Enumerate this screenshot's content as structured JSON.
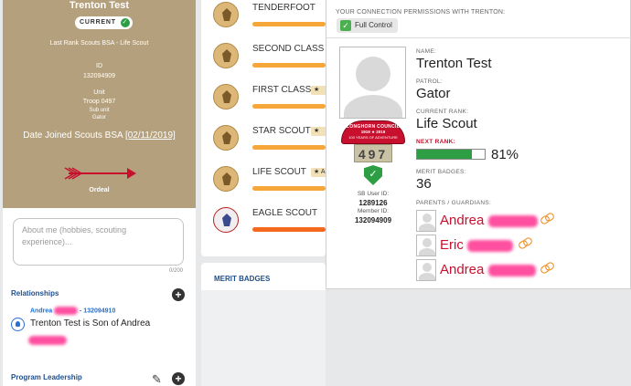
{
  "profile": {
    "name": "Trenton Test",
    "status": "CURRENT",
    "last_rank": "Last Rank Scouts BSA - Life Scout",
    "id_label": "ID",
    "id_value": "132094909",
    "unit_label": "Unit",
    "unit_value": "Troop 0497",
    "subunit_label": "Sub unit",
    "subunit_value": "Gator",
    "date_joined_label": "Date Joined Scouts BSA",
    "date_joined_value": "[02/11/2019]",
    "ordeal": "Ordeal"
  },
  "about": {
    "placeholder": "About me (hobbies, scouting experience)...",
    "count": "0/200"
  },
  "relationships": {
    "title": "Relationships",
    "link_prefix": "Andrea",
    "link_suffix": "- 132094910",
    "text": "Trenton Test is Son of Andrea"
  },
  "program_leadership": {
    "title": "Program Leadership"
  },
  "ranks": {
    "items": [
      {
        "name": "TENDERFOOT",
        "tag": "",
        "progress": 1.0
      },
      {
        "name": "SECOND CLASS",
        "tag": "",
        "progress": 1.0
      },
      {
        "name": "FIRST CLASS",
        "tag": "★",
        "progress": 1.0
      },
      {
        "name": "STAR SCOUT",
        "tag": "★",
        "progress": 1.0
      },
      {
        "name": "LIFE SCOUT",
        "tag": "★ A",
        "progress": 1.0
      },
      {
        "name": "EAGLE SCOUT",
        "tag": "",
        "progress": 1.0
      }
    ]
  },
  "merit_badges_tab": "MERIT BADGES",
  "popup": {
    "permissions_header": "YOUR CONNECTION PERMISSIONS WITH TRENTON:",
    "permission": "Full Control",
    "council_patch_line1": "LONGHORN COUNCIL",
    "council_patch_line2": "1919 ★ 2019",
    "council_patch_line3": "100 YEARS OF ADVENTURE",
    "unit_number": "497",
    "sb_user_id_label": "SB User ID:",
    "sb_user_id": "1289126",
    "member_id_label": "Member ID:",
    "member_id": "132094909",
    "name_label": "NAME:",
    "name": "Trenton Test",
    "patrol_label": "PATROL:",
    "patrol": "Gator",
    "current_rank_label": "CURRENT RANK:",
    "current_rank": "Life Scout",
    "next_rank_label": "NEXT RANK:",
    "next_rank_progress_text": "81%",
    "next_rank_progress": 0.81,
    "merit_badges_label": "MERIT BADGES:",
    "merit_badges": "36",
    "guardians_label": "PARENTS / GUARDIANS:",
    "guardians": [
      {
        "first": "Andrea"
      },
      {
        "first": "Eric"
      },
      {
        "first": "Andrea"
      }
    ]
  },
  "colors": {
    "card_tan": "#b4a07c",
    "link_blue": "#1f4e8c",
    "accent_red": "#c8102e",
    "progress_green": "#2e9e44",
    "rank_bar_orange": "#f7a73a"
  }
}
